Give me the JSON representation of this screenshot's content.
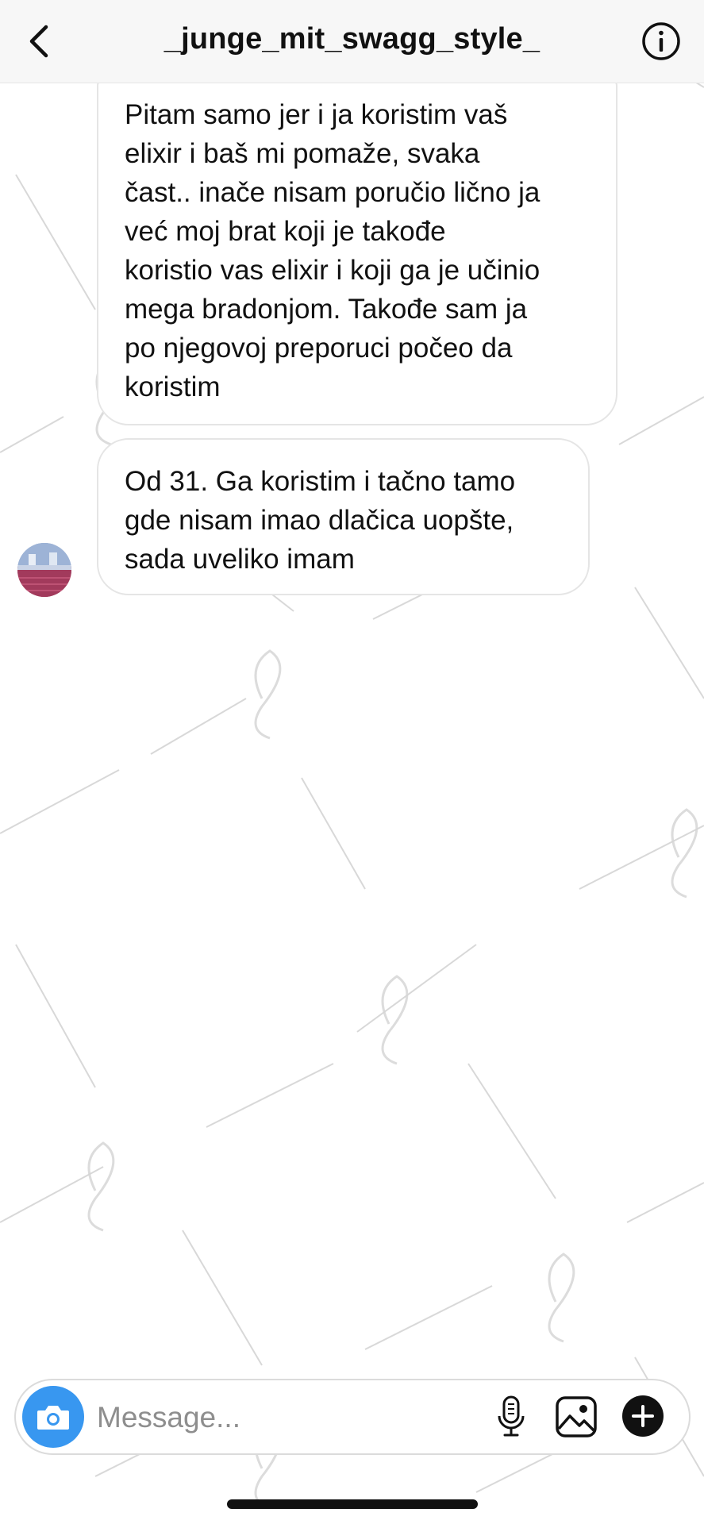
{
  "header": {
    "title": "_junge_mit_swagg_style_",
    "back_icon": "chevron-left-icon",
    "info_icon": "info-icon"
  },
  "messages": [
    {
      "lines": [
        "Pitam samo jer i ja koristim vaš",
        "elixir i baš mi pomaže, svaka",
        "čast.. inače nisam poručio lično ja",
        "već moj brat koji je takođe",
        "koristio vas elixir i koji ga je učinio",
        "mega bradonjom. Takođe sam ja",
        "po njegovoj preporuci počeo da",
        "koristim"
      ]
    },
    {
      "lines": [
        "Od 31. Ga koristim i tačno tamo",
        "gde nisam imao dlačica uopšte,",
        "sada uveliko imam"
      ]
    }
  ],
  "composer": {
    "placeholder": "Message...",
    "camera_icon": "camera-icon",
    "mic_icon": "microphone-icon",
    "gallery_icon": "gallery-icon",
    "plus_icon": "plus-icon"
  },
  "colors": {
    "accent": "#3897f0",
    "bubble_border": "#e5e5e5",
    "header_bg": "#f7f7f7",
    "text": "#111111",
    "placeholder": "#8e8e8e"
  }
}
